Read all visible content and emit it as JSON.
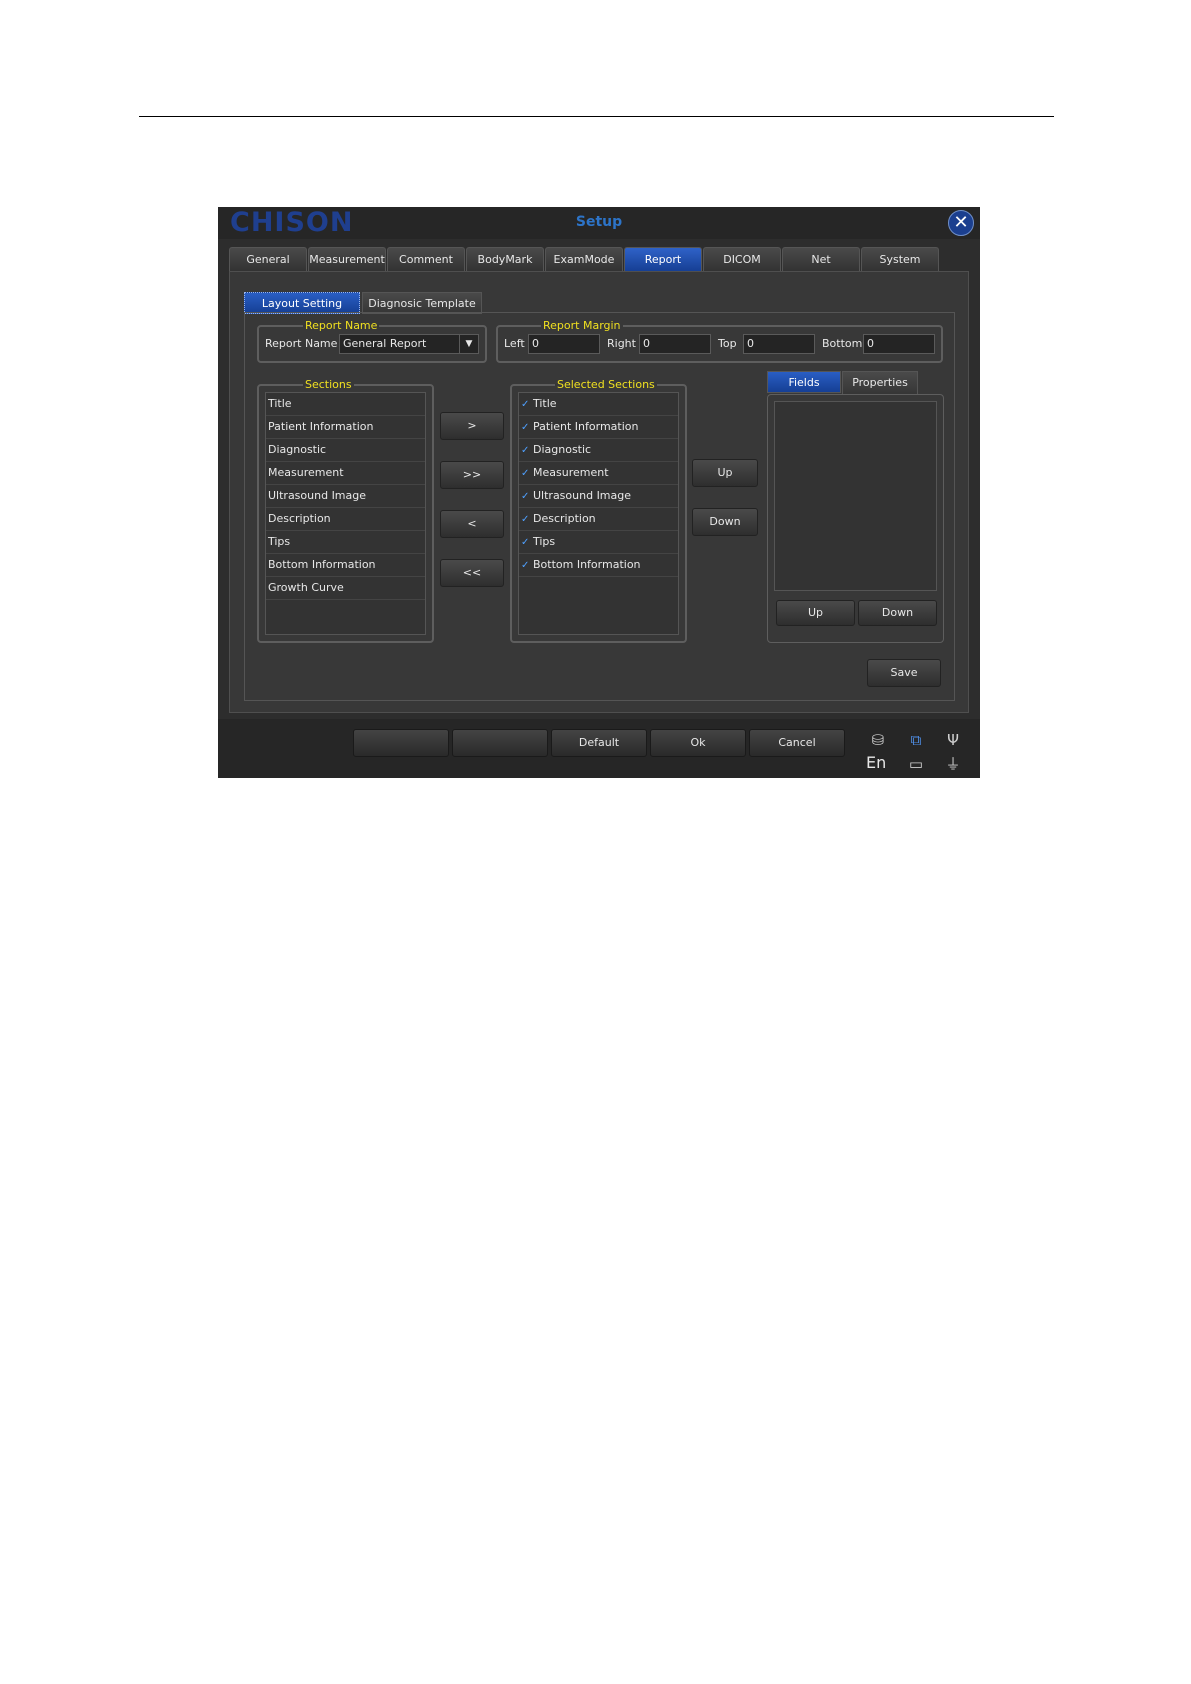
{
  "window": {
    "logo": "CHISON",
    "title": "Setup"
  },
  "tabs": [
    {
      "label": "General"
    },
    {
      "label": "Measurement"
    },
    {
      "label": "Comment"
    },
    {
      "label": "BodyMark"
    },
    {
      "label": "ExamMode"
    },
    {
      "label": "Report"
    },
    {
      "label": "DICOM"
    },
    {
      "label": "Net"
    },
    {
      "label": "System"
    }
  ],
  "active_tab": "Report",
  "subtabs": {
    "layout": "Layout Setting",
    "template": "Diagnosic Template"
  },
  "report_name": {
    "group_label": "Report Name",
    "field_label": "Report Name",
    "value": "General Report"
  },
  "report_margin": {
    "group_label": "Report Margin",
    "left_label": "Left",
    "left_value": "0",
    "right_label": "Right",
    "right_value": "0",
    "top_label": "Top",
    "top_value": "0",
    "bottom_label": "Bottom",
    "bottom_value": "0"
  },
  "sections": {
    "group_label": "Sections",
    "items": [
      "Title",
      "Patient Information",
      "Diagnostic",
      "Measurement",
      "Ultrasound Image",
      "Description",
      "Tips",
      "Bottom Information",
      "Growth Curve"
    ]
  },
  "transfer_buttons": {
    "add": ">",
    "add_all": ">>",
    "remove": "<",
    "remove_all": "<<"
  },
  "selected_sections": {
    "group_label": "Selected Sections",
    "items": [
      "Title",
      "Patient Information",
      "Diagnostic",
      "Measurement",
      "Ultrasound Image",
      "Description",
      "Tips",
      "Bottom Information"
    ]
  },
  "order_buttons": {
    "up": "Up",
    "down": "Down"
  },
  "fields_panel": {
    "tab_fields": "Fields",
    "tab_properties": "Properties",
    "up": "Up",
    "down": "Down"
  },
  "save_label": "Save",
  "bottom_buttons": {
    "default": "Default",
    "ok": "Ok",
    "cancel": "Cancel"
  },
  "status": {
    "language": "En"
  },
  "icons": [
    "database-icon",
    "network-icon",
    "usb-icon",
    "printer-icon",
    "power-plug-icon"
  ]
}
